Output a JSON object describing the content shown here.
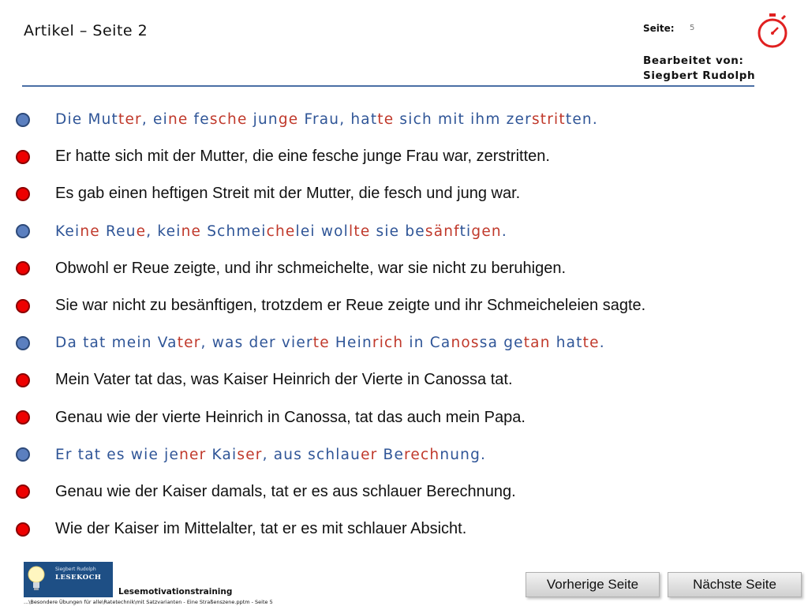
{
  "header": {
    "title": "Artikel – Seite 2",
    "seite_label": "Seite:",
    "seite_number": "5",
    "bearbeitet_label": "Bearbeitet von:",
    "author": "Siegbert Rudolph",
    "timer_icon": "stopwatch-icon"
  },
  "colors": {
    "accent_blue": "#2f5597",
    "accent_red": "#c0392b",
    "dot_blue": "#5b7fbf",
    "dot_red": "#ee0000",
    "rule": "#4a6fa5"
  },
  "rows": [
    {
      "dot": "blue",
      "style": "highlight",
      "segments": [
        {
          "t": "Die Mut",
          "c": "blue"
        },
        {
          "t": "ter",
          "c": "red"
        },
        {
          "t": ", ei",
          "c": "blue"
        },
        {
          "t": "ne",
          "c": "red"
        },
        {
          "t": " fe",
          "c": "blue"
        },
        {
          "t": "sche",
          "c": "red"
        },
        {
          "t": " jun",
          "c": "blue"
        },
        {
          "t": "ge",
          "c": "red"
        },
        {
          "t": " Frau, hat",
          "c": "blue"
        },
        {
          "t": "te",
          "c": "red"
        },
        {
          "t": " sich mit ihm zer",
          "c": "blue"
        },
        {
          "t": "strit",
          "c": "red"
        },
        {
          "t": "ten.",
          "c": "blue"
        }
      ]
    },
    {
      "dot": "red",
      "style": "plain",
      "text": "Er hatte sich mit der Mutter, die eine fesche junge Frau war, zerstritten."
    },
    {
      "dot": "red",
      "style": "plain",
      "text": "Es gab einen heftigen Streit mit der Mutter, die fesch und jung war."
    },
    {
      "dot": "blue",
      "style": "highlight",
      "segments": [
        {
          "t": "Kei",
          "c": "blue"
        },
        {
          "t": "ne",
          "c": "red"
        },
        {
          "t": " Reu",
          "c": "blue"
        },
        {
          "t": "e",
          "c": "red"
        },
        {
          "t": ", kei",
          "c": "blue"
        },
        {
          "t": "ne",
          "c": "red"
        },
        {
          "t": " Schmei",
          "c": "blue"
        },
        {
          "t": "che",
          "c": "red"
        },
        {
          "t": "lei wol",
          "c": "blue"
        },
        {
          "t": "lte",
          "c": "red"
        },
        {
          "t": " sie be",
          "c": "blue"
        },
        {
          "t": "sänf",
          "c": "red"
        },
        {
          "t": "ti",
          "c": "blue"
        },
        {
          "t": "gen",
          "c": "red"
        },
        {
          "t": ".",
          "c": "blue"
        }
      ]
    },
    {
      "dot": "red",
      "style": "plain",
      "text": "Obwohl er Reue zeigte, und ihr schmeichelte, war sie nicht zu beruhigen."
    },
    {
      "dot": "red",
      "style": "plain",
      "text": "Sie war nicht zu besänftigen, trotzdem er Reue zeigte und ihr Schmeicheleien sagte."
    },
    {
      "dot": "blue",
      "style": "highlight",
      "segments": [
        {
          "t": "Da tat mein Va",
          "c": "blue"
        },
        {
          "t": "ter",
          "c": "red"
        },
        {
          "t": ", was der vier",
          "c": "blue"
        },
        {
          "t": "te",
          "c": "red"
        },
        {
          "t": " Hein",
          "c": "blue"
        },
        {
          "t": "rich",
          "c": "red"
        },
        {
          "t": " in Ca",
          "c": "blue"
        },
        {
          "t": "nos",
          "c": "red"
        },
        {
          "t": "sa ge",
          "c": "blue"
        },
        {
          "t": "tan",
          "c": "red"
        },
        {
          "t": " hat",
          "c": "blue"
        },
        {
          "t": "te",
          "c": "red"
        },
        {
          "t": ".",
          "c": "blue"
        }
      ]
    },
    {
      "dot": "red",
      "style": "plain",
      "text": "Mein Vater tat das, was Kaiser Heinrich der Vierte in Canossa tat."
    },
    {
      "dot": "red",
      "style": "plain",
      "text": "Genau wie der vierte Heinrich in Canossa, tat das auch mein Papa."
    },
    {
      "dot": "blue",
      "style": "highlight",
      "segments": [
        {
          "t": "Er tat es wie je",
          "c": "blue"
        },
        {
          "t": "ner",
          "c": "red"
        },
        {
          "t": " Kai",
          "c": "blue"
        },
        {
          "t": "ser",
          "c": "red"
        },
        {
          "t": ", aus schlau",
          "c": "blue"
        },
        {
          "t": "er",
          "c": "red"
        },
        {
          "t": " Be",
          "c": "blue"
        },
        {
          "t": "rech",
          "c": "red"
        },
        {
          "t": "nung.",
          "c": "blue"
        }
      ]
    },
    {
      "dot": "red",
      "style": "plain",
      "text": "Genau wie der Kaiser damals, tat er es aus schlauer Berechnung."
    },
    {
      "dot": "red",
      "style": "plain",
      "text": "Wie der Kaiser im Mittelalter, tat er es mit schlauer Absicht."
    }
  ],
  "footer": {
    "logo_line1": "Siegbert Rudolph",
    "logo_line2": "LESEKOCH",
    "logo_icon": "lightbulb-icon",
    "training_label": "Lesemotivationstraining",
    "path": "...\\Besondere Übungen für alle\\Ratetechnik\\mit Satzvarianten - Eine Straßenszene.pptm - Seite 5",
    "prev_label": "Vorherige Seite",
    "next_label": "Nächste Seite"
  }
}
